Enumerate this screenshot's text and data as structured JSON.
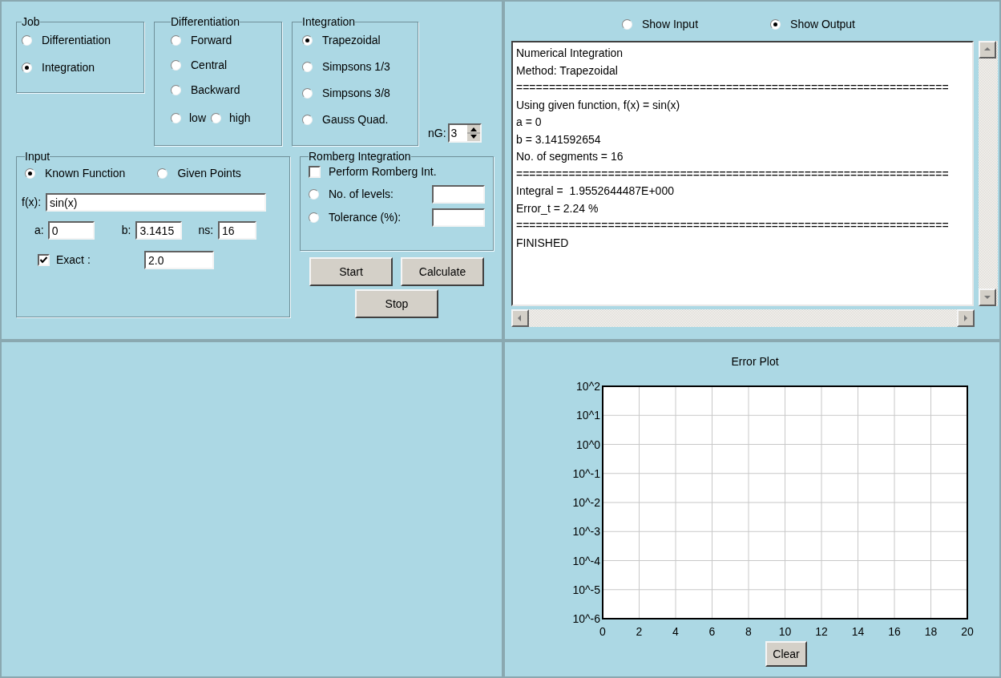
{
  "job": {
    "title": "Job",
    "options": [
      {
        "label": "Differentiation",
        "selected": false
      },
      {
        "label": "Integration",
        "selected": true
      }
    ]
  },
  "differentiation": {
    "title": "Differentiation",
    "options": [
      {
        "label": "Forward",
        "selected": false
      },
      {
        "label": "Central",
        "selected": false
      },
      {
        "label": "Backward",
        "selected": false
      }
    ],
    "accuracy": [
      {
        "label": "low",
        "selected": false
      },
      {
        "label": "high",
        "selected": false
      }
    ]
  },
  "integration": {
    "title": "Integration",
    "options": [
      {
        "label": "Trapezoidal",
        "selected": true
      },
      {
        "label": "Simpsons 1/3",
        "selected": false
      },
      {
        "label": "Simpsons 3/8",
        "selected": false
      },
      {
        "label": "Gauss Quad.",
        "selected": false
      }
    ],
    "ng": {
      "label": "nG:",
      "value": "3"
    }
  },
  "input": {
    "title": "Input",
    "sources": [
      {
        "label": "Known Function",
        "selected": true
      },
      {
        "label": "Given Points",
        "selected": false
      }
    ],
    "function": {
      "label": "f(x):",
      "value": "sin(x)"
    },
    "a": {
      "label": "a:",
      "value": "0"
    },
    "b": {
      "label": "b:",
      "value": "3.1415"
    },
    "ns": {
      "label": "ns:",
      "value": "16"
    },
    "exact": {
      "label": "Exact :",
      "checked": true,
      "value": "2.0"
    }
  },
  "romberg": {
    "title": "Romberg Integration",
    "perform": {
      "label": "Perform Romberg Int.",
      "checked": false
    },
    "modes": [
      {
        "label": "No. of levels:",
        "selected": false
      },
      {
        "label": "Tolerance (%):",
        "selected": false
      }
    ]
  },
  "buttons": [
    "Start",
    "Calculate",
    "Stop"
  ],
  "output": {
    "views": [
      {
        "label": "Show Input",
        "selected": false
      },
      {
        "label": "Show Output",
        "selected": true
      }
    ],
    "lines": [
      "Numerical Integration",
      "Method: Trapezoidal",
      "==================================================================",
      "Using given function, f(x) = sin(x)",
      "a = 0",
      "b = 3.141592654",
      "No. of segments = 16",
      "==================================================================",
      "Integral =  1.9552644487E+000",
      "Error_t = 2.24 %",
      "==================================================================",
      "FINISHED"
    ]
  },
  "plot": {
    "title": "Error Plot",
    "x_axis_labels": [
      "0",
      "2",
      "4",
      "6",
      "8",
      "10",
      "12",
      "14",
      "16",
      "18",
      "20"
    ],
    "y_axis_labels": [
      "10^2",
      "10^1",
      "10^0",
      "10^-1",
      "10^-2",
      "10^-3",
      "10^-4",
      "10^-5",
      "10^-6"
    ],
    "clear_button": "Clear"
  }
}
